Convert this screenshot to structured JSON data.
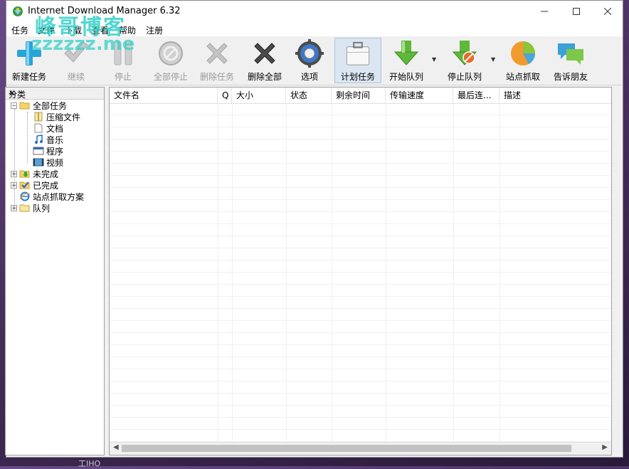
{
  "window": {
    "title": "Internet Download Manager 6.32"
  },
  "watermark": {
    "line1": "峰哥博客",
    "line2": "zzzzzz.me"
  },
  "menu": [
    "任务",
    "文件",
    "下载",
    "查看",
    "帮助",
    "注册"
  ],
  "toolbar": [
    {
      "label": "新建任务",
      "icon": "add-icon",
      "enabled": true
    },
    {
      "label": "继续",
      "icon": "resume-check-icon",
      "enabled": false
    },
    {
      "label": "停止",
      "icon": "pause-icon",
      "enabled": false
    },
    {
      "label": "全部停止",
      "icon": "stop-all-icon",
      "enabled": false
    },
    {
      "label": "删除任务",
      "icon": "delete-icon",
      "enabled": false
    },
    {
      "label": "删除全部",
      "icon": "delete-all-icon",
      "enabled": true
    },
    {
      "label": "选项",
      "icon": "gear-icon",
      "enabled": true
    },
    {
      "label": "计划任务",
      "icon": "scheduler-icon",
      "enabled": true
    },
    {
      "label": "开始队列",
      "icon": "start-queue-icon",
      "enabled": true
    },
    {
      "label": "停止队列",
      "icon": "stop-queue-icon",
      "enabled": true
    },
    {
      "label": "站点抓取",
      "icon": "grabber-pie-icon",
      "enabled": true
    },
    {
      "label": "告诉朋友",
      "icon": "tell-friend-icon",
      "enabled": true
    }
  ],
  "sidebar": {
    "title": "分类",
    "tree": [
      {
        "label": "全部任务",
        "icon": "folder-open-icon",
        "level": 0,
        "expander": "−"
      },
      {
        "label": "压缩文件",
        "icon": "archive-icon",
        "level": 1
      },
      {
        "label": "文档",
        "icon": "document-icon",
        "level": 1
      },
      {
        "label": "音乐",
        "icon": "music-icon",
        "level": 1
      },
      {
        "label": "程序",
        "icon": "program-icon",
        "level": 1
      },
      {
        "label": "视频",
        "icon": "video-icon",
        "level": 1
      },
      {
        "label": "未完成",
        "icon": "unfinished-icon",
        "level": 0,
        "expander": "+"
      },
      {
        "label": "已完成",
        "icon": "finished-icon",
        "level": 0,
        "expander": "+"
      },
      {
        "label": "站点抓取方案",
        "icon": "ie-icon",
        "level": 0
      },
      {
        "label": "队列",
        "icon": "queue-folder-icon",
        "level": 0,
        "expander": "+"
      }
    ]
  },
  "list": {
    "columns": [
      "文件名",
      "Q",
      "大小",
      "状态",
      "剩余时间",
      "传输速度",
      "最后连...",
      "描述"
    ]
  },
  "taskbar": {
    "text": "工IHO"
  }
}
